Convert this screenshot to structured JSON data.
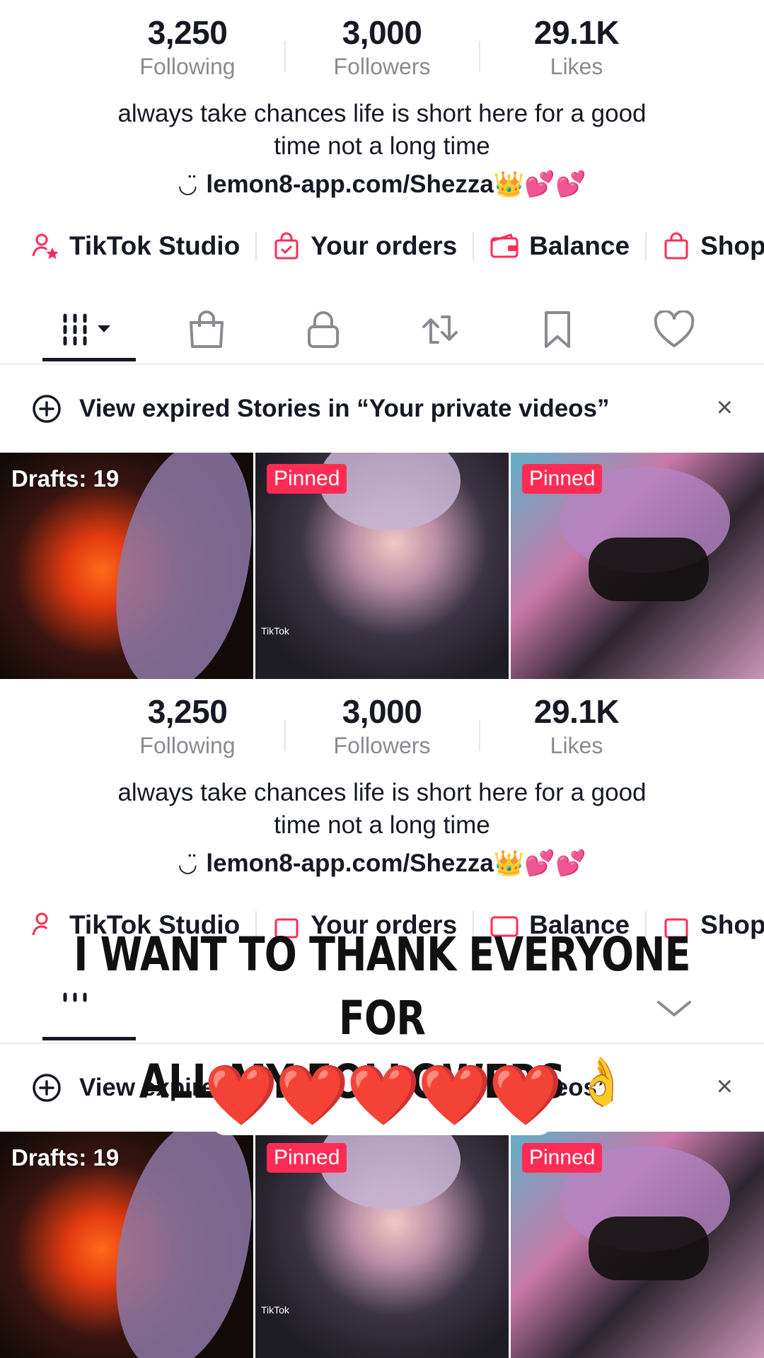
{
  "profile": {
    "following_count": "3,250",
    "following_label": "Following",
    "followers_count": "3,000",
    "followers_label": "Followers",
    "likes_count": "29.1K",
    "likes_label": "Likes",
    "bio_line1": "always take chances life is short here for a good",
    "bio_line2": "time not a long time",
    "link_text": "lemon8-app.com/Shezza👑💕💕",
    "link_icon": "link-smile-icon"
  },
  "actions": {
    "studio": "TikTok Studio",
    "orders": "Your orders",
    "balance": "Balance",
    "shop": "Shop"
  },
  "tabs": [
    "videos-grid",
    "shop",
    "private",
    "reposts",
    "favorites",
    "liked"
  ],
  "notice": {
    "text": "View expired Stories in “Your private videos”",
    "close": "×"
  },
  "grid": {
    "drafts_label": "Drafts: 19",
    "pinned_label": "Pinned",
    "watermark": "TikTok"
  },
  "overlay": {
    "line1": "I WANT TO THANK EVERYONE FOR",
    "line2": "ALL MY FOLLOWERS 👌",
    "hearts": "❤️❤️❤️❤️❤️"
  },
  "colors": {
    "accent": "#fe2c55",
    "text": "#161823",
    "muted": "#8a8b91"
  }
}
